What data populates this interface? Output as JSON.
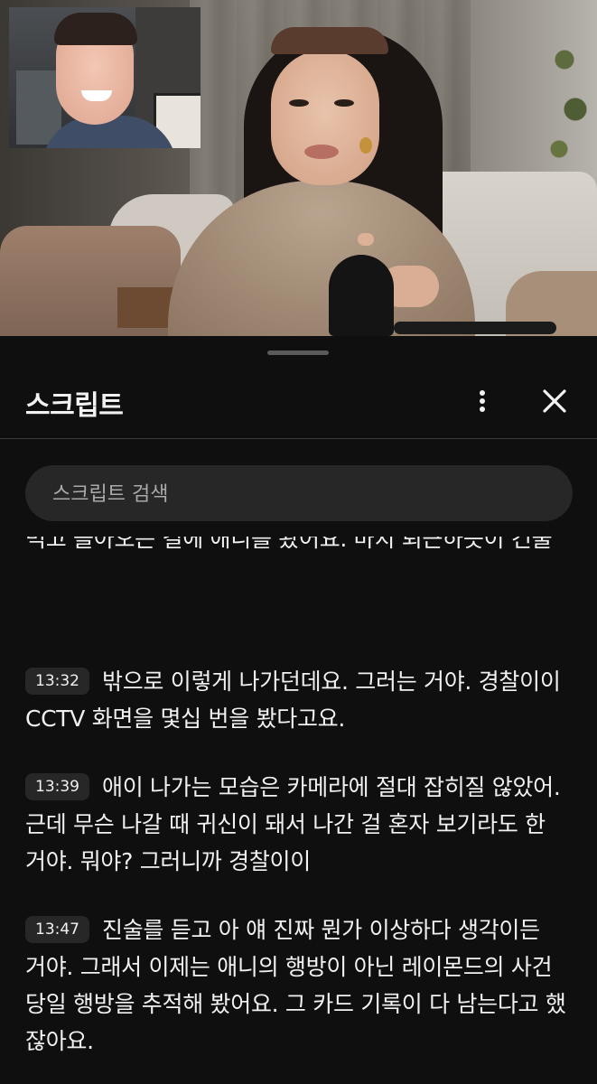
{
  "sheet": {
    "title": "스크립트",
    "more_icon": "more-vert-icon",
    "close_icon": "close-icon"
  },
  "search": {
    "placeholder": "스크립트 검색",
    "value": ""
  },
  "transcript": {
    "partial_top": {
      "text": "먹고 돌아오는 길에 애니를 봤어요. 마치 퇴근하듯이 건물"
    },
    "segments": [
      {
        "time": "13:32",
        "text": "밖으로 이렇게 나가던데요. 그러는 거야. 경찰이이 CCTV 화면을 몇십 번을 봤다고요."
      },
      {
        "time": "13:39",
        "text": "애이 나가는 모습은 카메라에 절대 잡히질 않았어. 근데 무슨 나갈 때 귀신이 돼서 나간 걸 혼자 보기라도 한 거야. 뭐야? 그러니까 경찰이이"
      },
      {
        "time": "13:47",
        "text": "진술를 듣고 아 얘 진짜 뭔가 이상하다 생각이든 거야. 그래서 이제는 애니의 행방이 아닌 레이몬드의 사건 당일 행방을 추적해 봤어요. 그 카드 기록이 다 남는다고 했잖아요."
      }
    ]
  },
  "colors": {
    "background": "#0f0f0f",
    "surface": "#272727",
    "text": "#f1f1f1",
    "placeholder": "#aaaaaa",
    "divider": "#3a3a3a"
  }
}
